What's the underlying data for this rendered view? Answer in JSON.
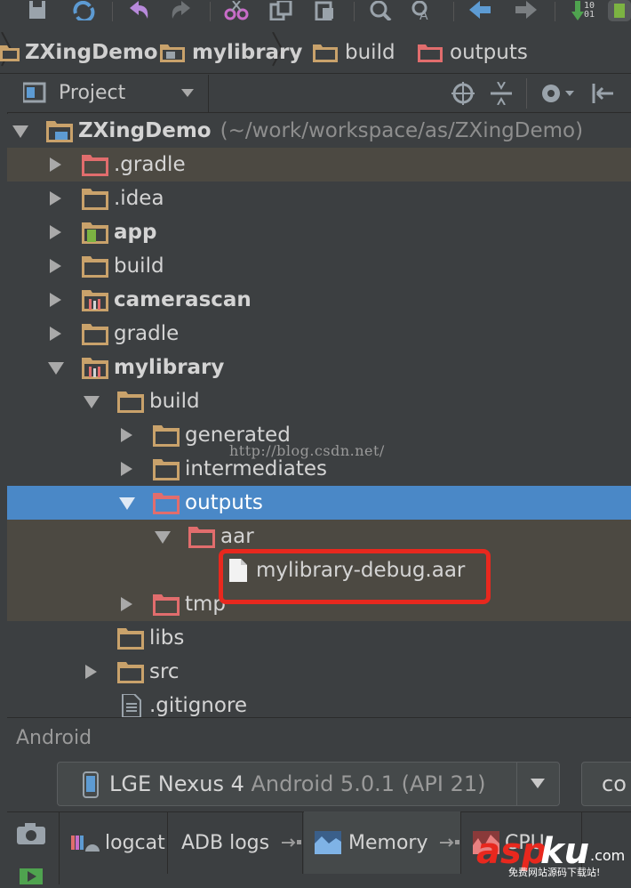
{
  "colors": {
    "background": "#3c3f41",
    "selection": "#4a88c7",
    "highlight_row": "#4c4942",
    "folder": "#c9a26b",
    "excluded_folder": "#e16d6d",
    "red_box": "#e8281e"
  },
  "toolbar": {
    "icons": [
      "save-icon",
      "sync-icon",
      "undo-icon",
      "redo-icon",
      "cut-icon",
      "copy-icon",
      "paste-icon",
      "find-icon",
      "replace-icon",
      "back-icon",
      "forward-icon",
      "make-icon",
      "android-icon"
    ],
    "partial_text": "10\n01"
  },
  "breadcrumb": {
    "items": [
      "ZXingDemo",
      "mylibrary",
      "build",
      "outputs"
    ]
  },
  "project_panel": {
    "view_label": "Project"
  },
  "tree": {
    "root_label": "ZXingDemo",
    "root_path": "(~/work/workspace/as/ZXingDemo)",
    "items": [
      {
        "label": ".gradle"
      },
      {
        "label": ".idea"
      },
      {
        "label": "app"
      },
      {
        "label": "build"
      },
      {
        "label": "camerascan"
      },
      {
        "label": "gradle"
      },
      {
        "label": "mylibrary"
      },
      {
        "label": "build"
      },
      {
        "label": "generated"
      },
      {
        "label": "intermediates"
      },
      {
        "label": "outputs"
      },
      {
        "label": "aar"
      },
      {
        "label": "mylibrary-debug.aar"
      },
      {
        "label": "tmp"
      },
      {
        "label": "libs"
      },
      {
        "label": "src"
      },
      {
        "label": ".gitignore"
      }
    ]
  },
  "watermark": "http://blog.csdn.net/",
  "android_panel": {
    "title": "Android",
    "device_name": "LGE Nexus 4",
    "device_os": "Android 5.0.1 (API 21)",
    "process_partial": "co",
    "tabs": [
      "logcat",
      "ADB logs",
      "Memory",
      "CPU"
    ]
  },
  "site_logo": {
    "brand_red": "asp",
    "brand_white": "ku",
    "tld": ".com",
    "tagline": "免费网站源码下载站!"
  }
}
